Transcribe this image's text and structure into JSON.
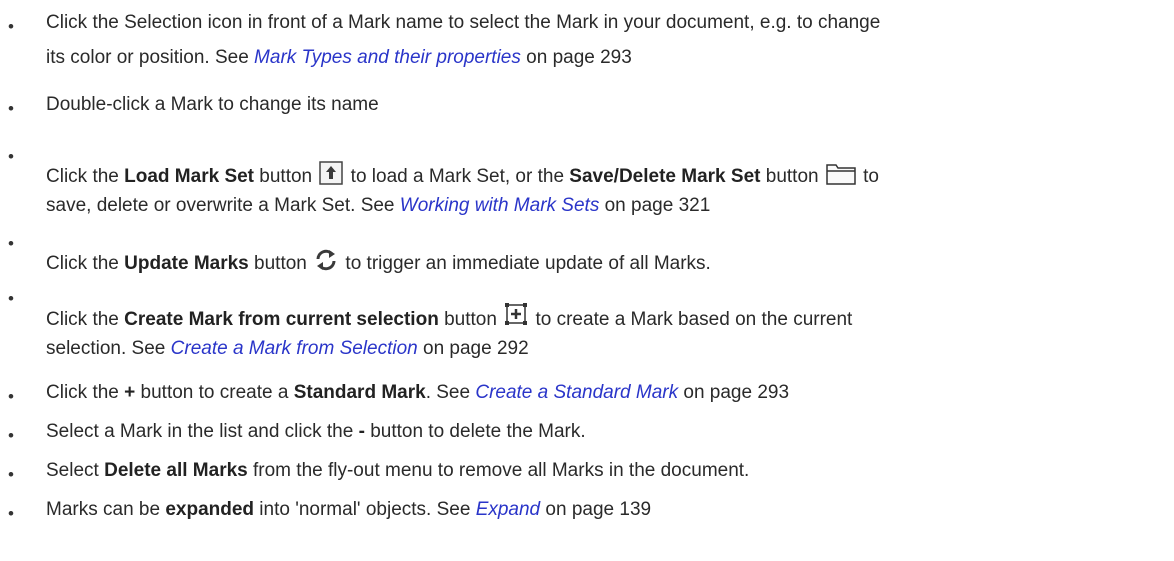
{
  "items": [
    {
      "line1": {
        "text": "Click the Selection icon in front of a Mark name to select the Mark in your document, e.g. to change"
      },
      "line2": {
        "pre": "its color or position. See ",
        "link": "Mark Types and their properties",
        "post": " on page 293"
      }
    },
    {
      "text": "Double-click a Mark to change its name"
    },
    {
      "line1": {
        "t1": "Click the ",
        "b1": "Load Mark Set",
        "t2": " button",
        "t3": " to load a Mark Set, or the ",
        "b2": "Save/Delete Mark Set",
        "t4": " button",
        "t5": " to"
      },
      "line2": {
        "pre": "save, delete or overwrite a Mark Set. See ",
        "link": "Working with Mark Sets",
        "post": " on page 321"
      }
    },
    {
      "t1": "Click the ",
      "b1": "Update Marks",
      "t2": " button",
      "t3": " to trigger an immediate update of all Marks."
    },
    {
      "line1": {
        "t1": "Click the ",
        "b1": "Create Mark from current selection",
        "t2": " button",
        "t3": " to create a Mark based on the current"
      },
      "line2": {
        "pre": "selection. See ",
        "link": "Create a Mark from Selection",
        "post": " on page 292"
      }
    },
    {
      "t1": "Click the ",
      "b1": "+",
      "t2": " button to create a ",
      "b2": "Standard Mark",
      "t3": ". See ",
      "link": "Create a Standard Mark",
      "post": " on page 293"
    },
    {
      "t1": "Select a Mark in the list and click the ",
      "b1": "-",
      "t2": " button to delete the Mark."
    },
    {
      "t1": "Select ",
      "b1": "Delete all Marks",
      "t2": " from the fly-out menu to remove all Marks in the document."
    },
    {
      "t1": "Marks can be ",
      "b1": "expanded",
      "t2": " into 'normal' objects. See ",
      "link": "Expand",
      "post": " on page 139"
    }
  ],
  "bullet": "•",
  "icons": {
    "load": "upload-arrow-icon",
    "save": "folder-icon",
    "update": "refresh-icon",
    "create": "selection-plus-icon"
  }
}
